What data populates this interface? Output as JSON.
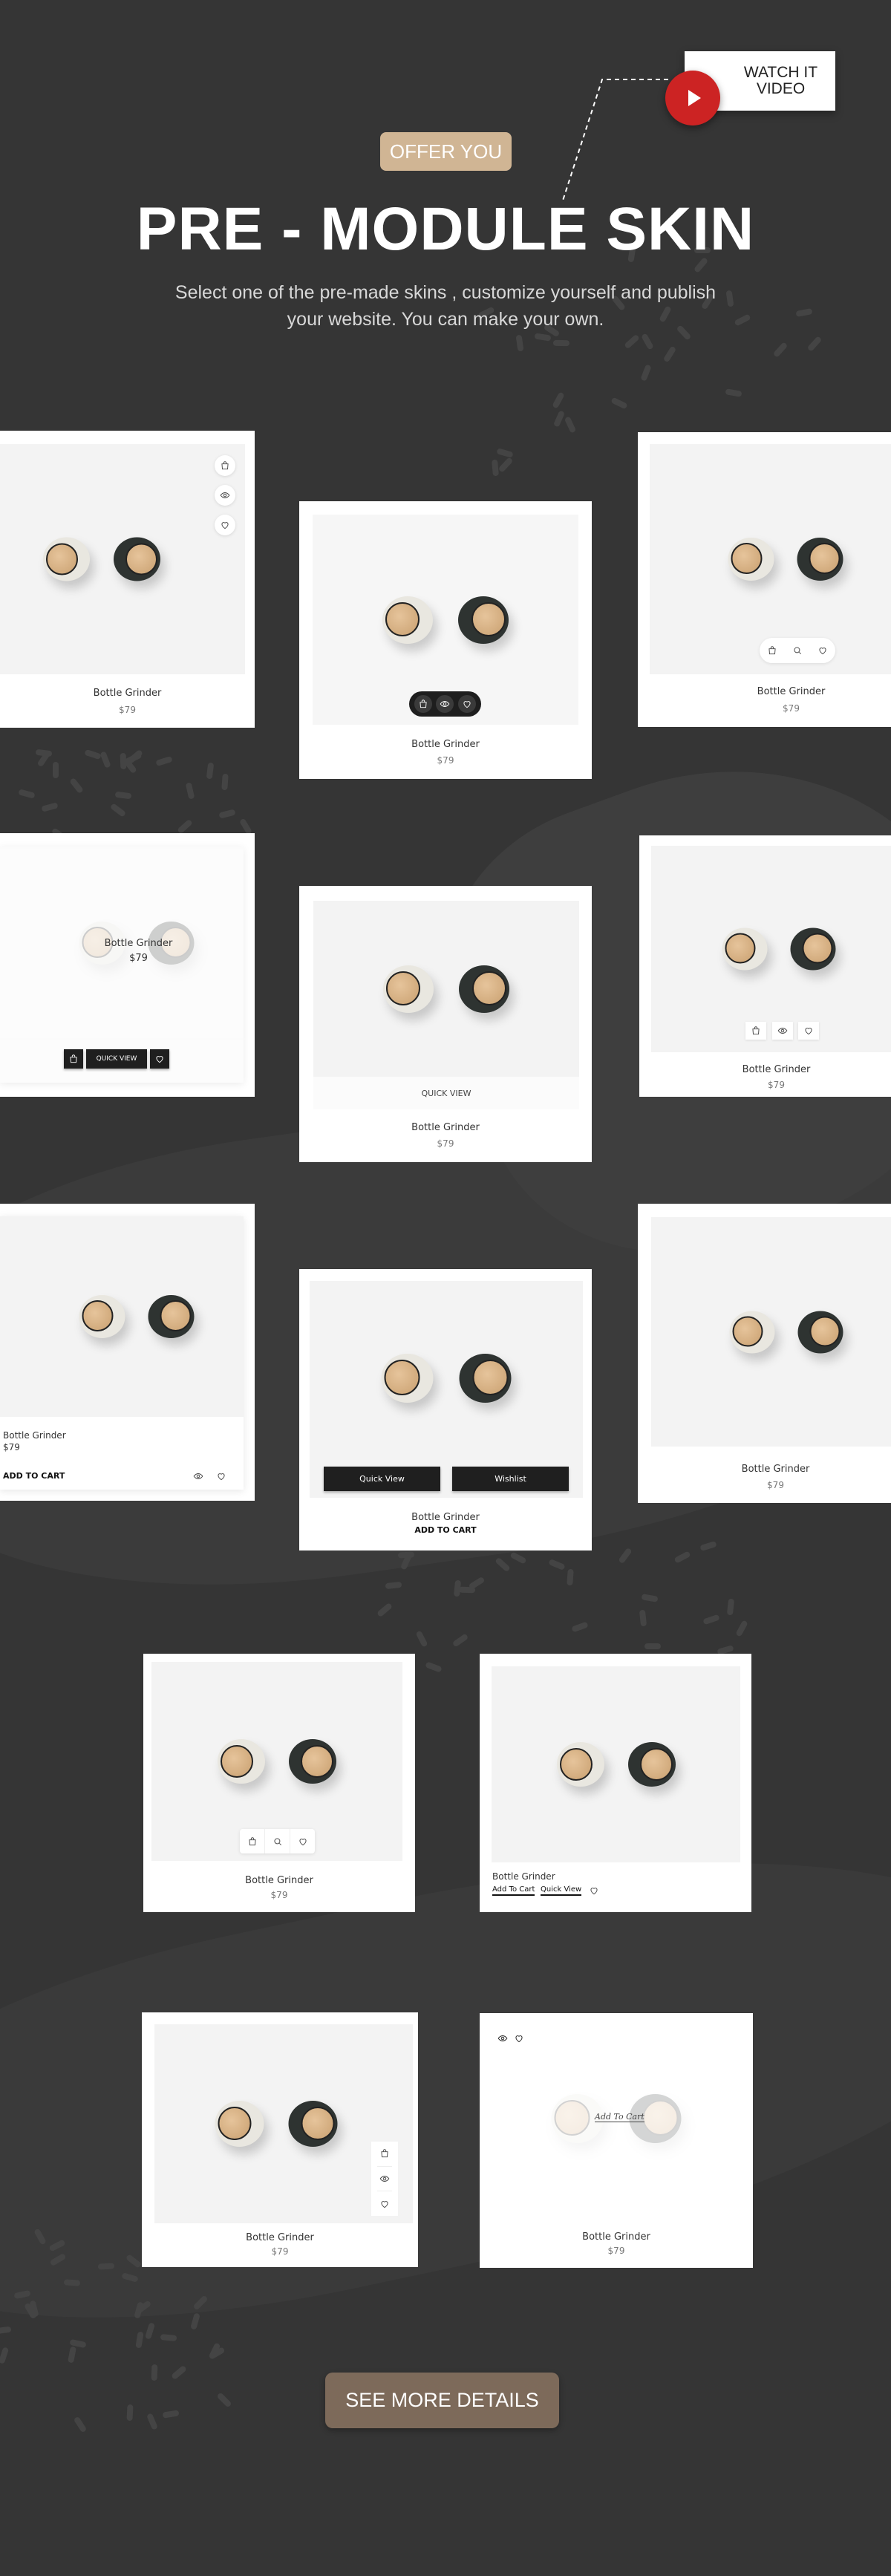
{
  "header": {
    "video_line1": "WATCH IT",
    "video_line2": "VIDEO",
    "badge": "OFFER YOU",
    "title": "PRE - MODULE SKIN",
    "subtitle_line1": "Select one of the pre-made skins , customize yourself and publish",
    "subtitle_line2": "your website. You can make your own."
  },
  "colors": {
    "background": "#353535",
    "badge": "#d0b594",
    "video_button": "#cc2323",
    "cta": "#7d6a5a"
  },
  "cards": [
    {
      "name": "Bottle Grinder",
      "price": "$79",
      "icons": [
        "bag-icon",
        "eye-icon",
        "heart-icon"
      ]
    },
    {
      "name": "Bottle Grinder",
      "price": "$79",
      "icons": [
        "bag-icon",
        "eye-icon",
        "heart-icon"
      ]
    },
    {
      "name": "Bottle Grinder",
      "price": "$79",
      "icons": [
        "bag-icon",
        "search-icon",
        "heart-icon"
      ]
    },
    {
      "name": "Bottle Grinder",
      "price": "$79",
      "quick_view": "QUICK VIEW",
      "icons": [
        "bag-icon",
        "heart-icon"
      ]
    },
    {
      "name": "Bottle Grinder",
      "price": "$79",
      "quick_view": "QUICK VIEW"
    },
    {
      "name": "Bottle Grinder",
      "price": "$79",
      "icons": [
        "bag-icon",
        "eye-icon",
        "heart-icon"
      ]
    },
    {
      "name": "Bottle Grinder",
      "price": "$79",
      "add_to_cart": "ADD TO CART",
      "icons": [
        "eye-icon",
        "heart-icon"
      ]
    },
    {
      "name": "Bottle Grinder",
      "add_to_cart": "ADD TO CART",
      "quick_view": "Quick View",
      "wishlist": "Wishlist"
    },
    {
      "name": "Bottle Grinder",
      "price": "$79"
    },
    {
      "name": "Bottle Grinder",
      "price": "$79",
      "icons": [
        "bag-icon",
        "search-icon",
        "heart-icon"
      ]
    },
    {
      "name": "Bottle Grinder",
      "add_to_cart": "Add To Cart",
      "quick_view": "Quick View",
      "icons": [
        "heart-icon"
      ]
    },
    {
      "name": "Bottle Grinder",
      "price": "$79",
      "icons": [
        "bag-icon",
        "eye-icon",
        "heart-icon"
      ]
    },
    {
      "name": "Bottle Grinder",
      "price": "$79",
      "add_to_cart": "Add To Cart",
      "icons": [
        "eye-icon",
        "heart-icon"
      ]
    }
  ],
  "cta": {
    "label": "SEE MORE DETAILS"
  }
}
